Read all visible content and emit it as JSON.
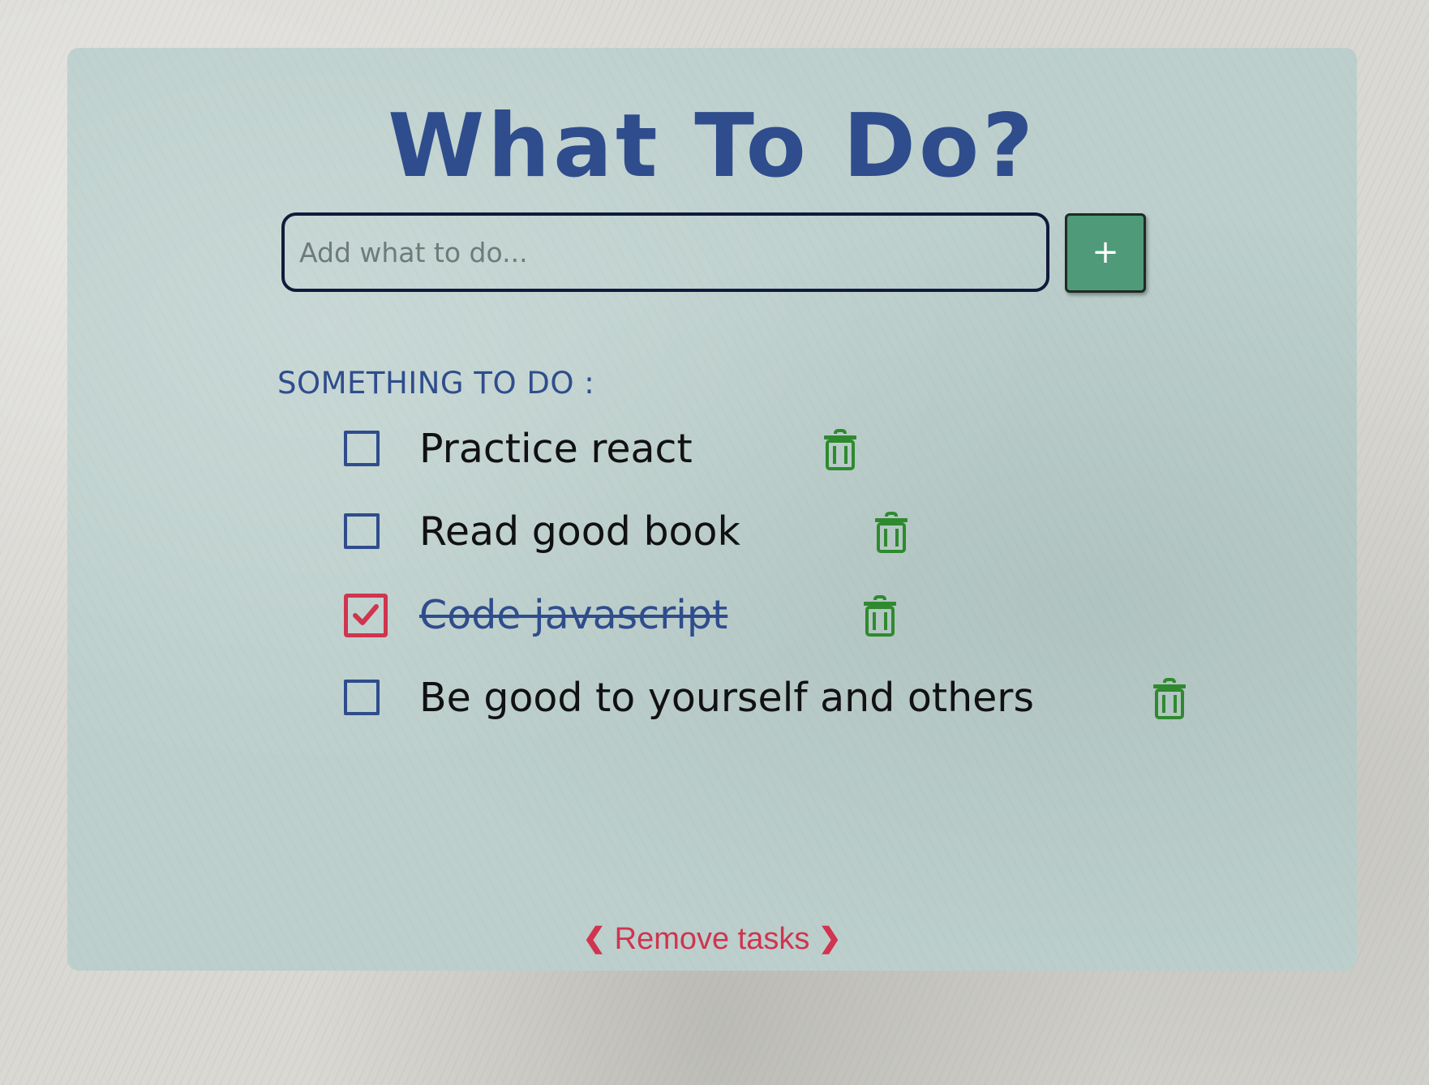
{
  "app": {
    "title": "What To Do?"
  },
  "add_form": {
    "placeholder": "Add what to do...",
    "value": "",
    "add_button_label": "+"
  },
  "list": {
    "heading": "SOMETHING TO DO :",
    "tasks": [
      {
        "text": "Practice react",
        "done": false
      },
      {
        "text": "Read good book",
        "done": false
      },
      {
        "text": "Code javascript",
        "done": true
      },
      {
        "text": "Be good to yourself and others",
        "done": false
      }
    ]
  },
  "footer": {
    "remove_label": "Remove tasks",
    "left_icon": "chevron-left-icon",
    "right_icon": "chevron-right-icon"
  },
  "icons": {
    "delete": "trash-icon",
    "checked": "checkmark-icon"
  },
  "colors": {
    "title_blue": "#2f4d8c",
    "add_button_green": "#4f9a78",
    "trash_green": "#2f8a2f",
    "accent_red": "#d0344f",
    "panel": "#bccfcc"
  }
}
